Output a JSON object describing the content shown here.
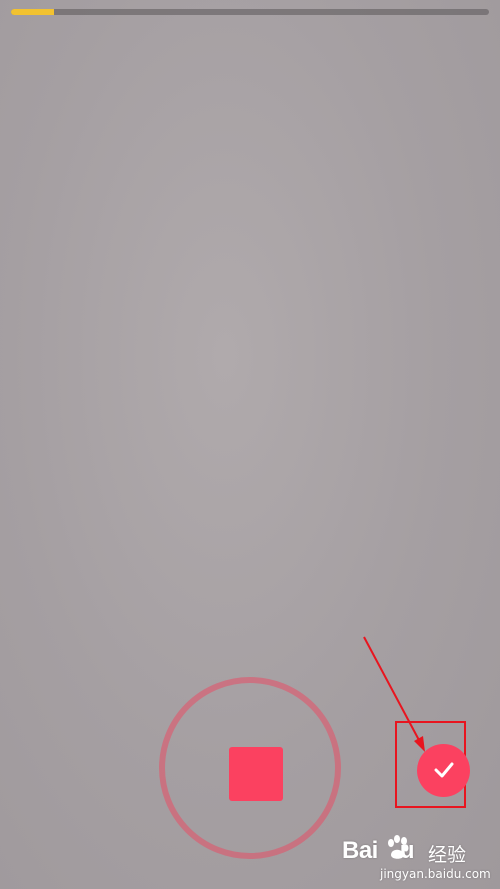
{
  "recorder": {
    "progress_fraction": 0.09,
    "progress_color": "#f2c230",
    "record_ring_color": "#e84e66",
    "stop_color": "#fb4160",
    "confirm_color": "#fb4160",
    "record_state": "recording",
    "stop_icon": "stop-square-icon",
    "confirm_icon": "check-icon"
  },
  "annotation": {
    "color": "#e8151f"
  },
  "watermark": {
    "logo_left": "Bai",
    "logo_right": "u",
    "name": "经验",
    "url": "jingyan.baidu.com"
  }
}
